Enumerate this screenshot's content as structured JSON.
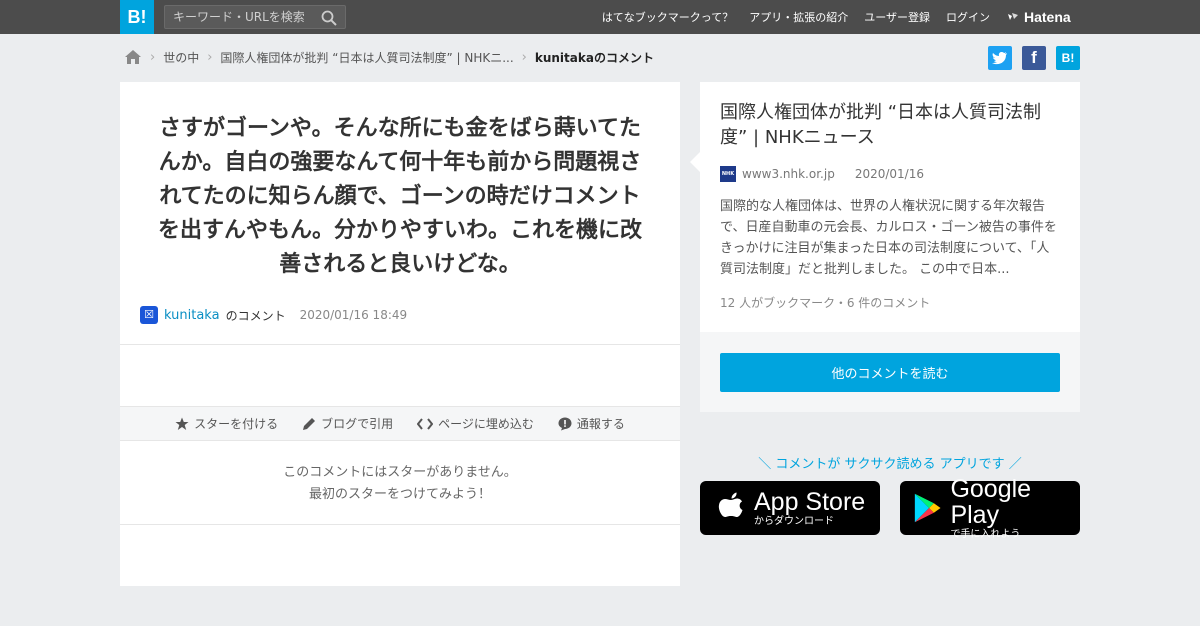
{
  "header": {
    "logo": "B!",
    "search_placeholder": "キーワード・URLを検索",
    "nav": [
      "はてなブックマークって？",
      "アプリ・拡張の紹介",
      "ユーザー登録",
      "ログイン"
    ],
    "brand": "Hatena"
  },
  "breadcrumb": {
    "category": "世の中",
    "entry": "国際人権団体が批判 “日本は人質司法制度” | NHKニ...",
    "current": "kunitakaのコメント"
  },
  "share": {
    "twitter": "twitter-icon",
    "facebook": "facebook-icon",
    "hatena": "B!"
  },
  "comment": {
    "text": "さすがゴーンや。そんな所にも金をばら蒔いてたんか。自白の強要なんて何十年も前から問題視されてたのに知らん顔で、ゴーンの時だけコメントを出すんやもん。分かりやすいわ。これを機に改善されると良いけどな。",
    "user": "kunitaka",
    "user_suffix": "のコメント",
    "date": "2020/01/16 18:49"
  },
  "actions": {
    "star": "スターを付ける",
    "blog": "ブログで引用",
    "embed": "ページに埋め込む",
    "report": "通報する"
  },
  "stars": {
    "line1": "このコメントにはスターがありません。",
    "line2": "最初のスターをつけてみよう！"
  },
  "article": {
    "title": "国際人権団体が批判 “日本は人質司法制度” | NHKニュース",
    "source": "www3.nhk.or.jp",
    "source_badge": "NHK",
    "date": "2020/01/16",
    "description": "国際的な人権団体は、世界の人権状況に関する年次報告で、日産自動車の元会長、カルロス・ゴーン被告の事件をきっかけに注目が集まった日本の司法制度について、「人質司法制度」だと批判しました。 この中で日本...",
    "counts": "12 人がブックマーク・6 件のコメント",
    "read_button": "他のコメントを読む"
  },
  "app_promo": {
    "tagline": "＼ コメントが サクサク読める アプリです ／",
    "appstore_big": "App Store",
    "appstore_small": "からダウンロード",
    "googleplay_big": "Google Play",
    "googleplay_small": "で手に入れよう"
  },
  "colors": {
    "accent": "#00a4de",
    "topbar": "#4c4c4c",
    "background": "#ebedef"
  }
}
